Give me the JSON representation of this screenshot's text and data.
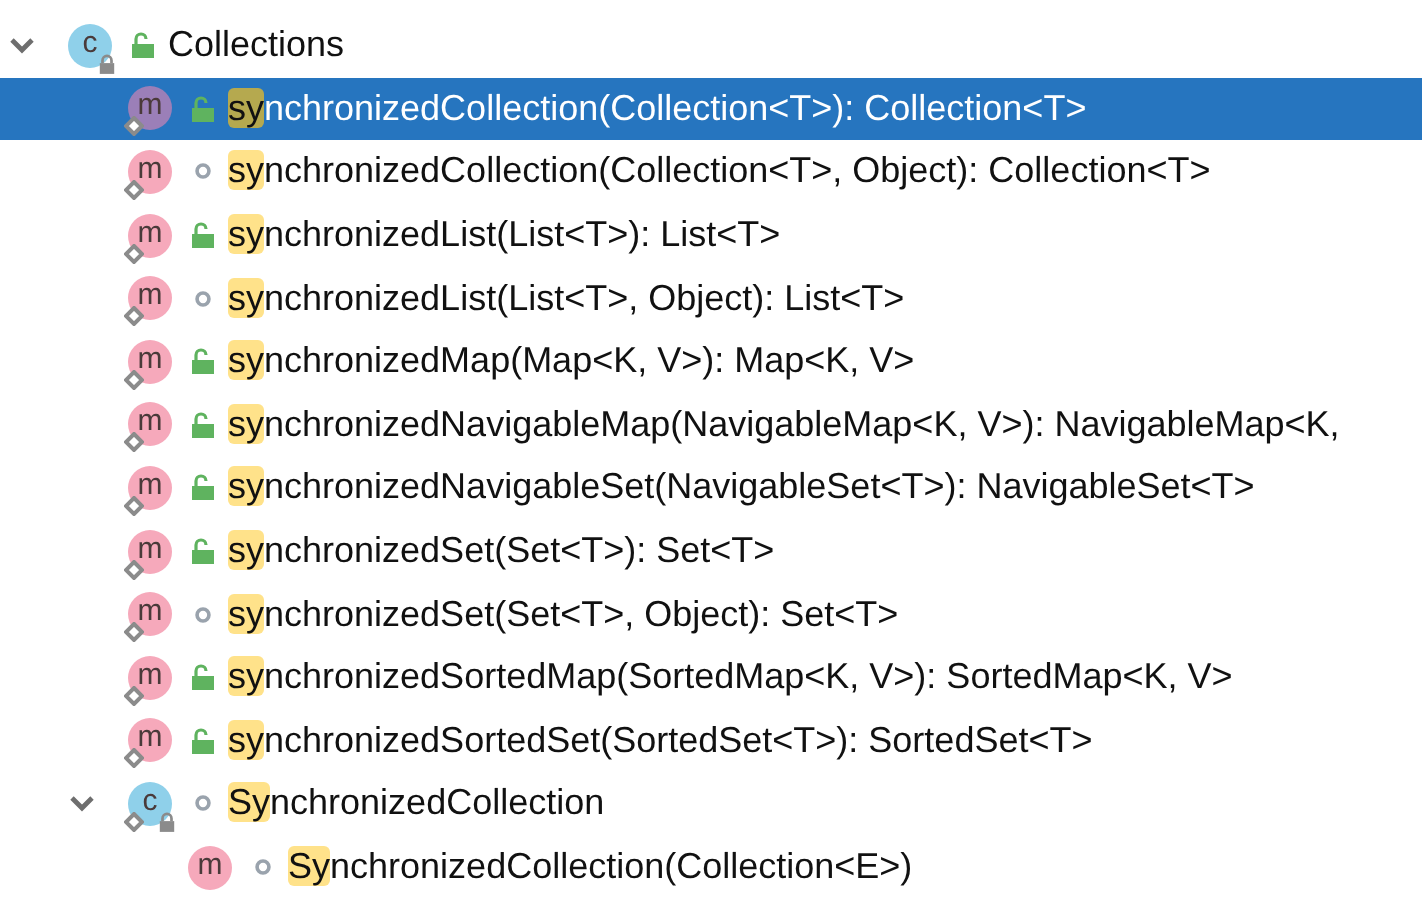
{
  "tree": [
    {
      "kind": "class",
      "letter": "c",
      "public": true,
      "static": false,
      "expanded": true,
      "selected": false,
      "rest": "Collections",
      "children": [
        {
          "kind": "method",
          "letter": "m",
          "public": true,
          "static": true,
          "selected": true,
          "match": "sy",
          "rest": "nchronizedCollection(Collection<T>): Collection<T>"
        },
        {
          "kind": "method",
          "letter": "m",
          "public": false,
          "static": true,
          "selected": false,
          "match": "sy",
          "rest": "nchronizedCollection(Collection<T>, Object): Collection<T>"
        },
        {
          "kind": "method",
          "letter": "m",
          "public": true,
          "static": true,
          "selected": false,
          "match": "sy",
          "rest": "nchronizedList(List<T>): List<T>"
        },
        {
          "kind": "method",
          "letter": "m",
          "public": false,
          "static": true,
          "selected": false,
          "match": "sy",
          "rest": "nchronizedList(List<T>, Object): List<T>"
        },
        {
          "kind": "method",
          "letter": "m",
          "public": true,
          "static": true,
          "selected": false,
          "match": "sy",
          "rest": "nchronizedMap(Map<K, V>): Map<K, V>"
        },
        {
          "kind": "method",
          "letter": "m",
          "public": true,
          "static": true,
          "selected": false,
          "match": "sy",
          "rest": "nchronizedNavigableMap(NavigableMap<K, V>): NavigableMap<K,"
        },
        {
          "kind": "method",
          "letter": "m",
          "public": true,
          "static": true,
          "selected": false,
          "match": "sy",
          "rest": "nchronizedNavigableSet(NavigableSet<T>): NavigableSet<T>"
        },
        {
          "kind": "method",
          "letter": "m",
          "public": true,
          "static": true,
          "selected": false,
          "match": "sy",
          "rest": "nchronizedSet(Set<T>): Set<T>"
        },
        {
          "kind": "method",
          "letter": "m",
          "public": false,
          "static": true,
          "selected": false,
          "match": "sy",
          "rest": "nchronizedSet(Set<T>, Object): Set<T>"
        },
        {
          "kind": "method",
          "letter": "m",
          "public": true,
          "static": true,
          "selected": false,
          "match": "sy",
          "rest": "nchronizedSortedMap(SortedMap<K, V>): SortedMap<K, V>"
        },
        {
          "kind": "method",
          "letter": "m",
          "public": true,
          "static": true,
          "selected": false,
          "match": "sy",
          "rest": "nchronizedSortedSet(SortedSet<T>): SortedSet<T>"
        },
        {
          "kind": "class",
          "letter": "c",
          "public": false,
          "static": true,
          "expanded": true,
          "selected": false,
          "match": "Sy",
          "rest": "nchronizedCollection",
          "children": [
            {
              "kind": "method",
              "letter": "m",
              "public": false,
              "static": false,
              "selected": false,
              "match": "Sy",
              "rest": "nchronizedCollection(Collection<E>)"
            }
          ]
        }
      ]
    }
  ]
}
